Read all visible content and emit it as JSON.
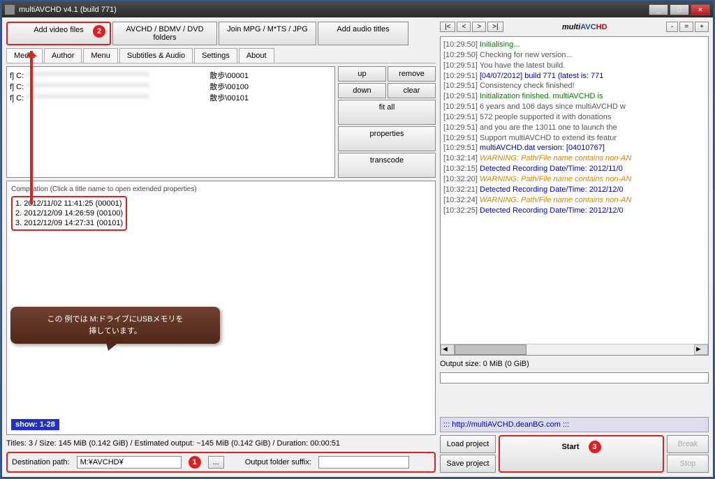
{
  "window": {
    "title": "multiAVCHD v4.1 (build 771)"
  },
  "topButtons": {
    "addVideo": "Add video files",
    "avchd": "AVCHD / BDMV / DVD folders",
    "joinmpg": "Join MPG / M*TS / JPG",
    "addAudio": "Add audio titles"
  },
  "tabs": {
    "media": "Media",
    "author": "Author",
    "menu": "Menu",
    "subtitles": "Subtitles & Audio",
    "settings": "Settings",
    "about": "About"
  },
  "fileRows": [
    {
      "prefix": "f] C:",
      "suffix": "散歩\\00001"
    },
    {
      "prefix": "f] C:",
      "suffix": "散歩\\00100"
    },
    {
      "prefix": "f] C:",
      "suffix": "散歩\\00101"
    }
  ],
  "side": {
    "up": "up",
    "remove": "remove",
    "down": "down",
    "clear": "clear",
    "fitall": "fit all",
    "properties": "properties",
    "transcode": "transcode"
  },
  "compilation": {
    "legend": "Compilation (Click a title name to open extended properties)",
    "items": [
      "1. 2012/11/02 11:41:25 (00001)",
      "2. 2012/12/09 14:26:59 (00100)",
      "3. 2012/12/09 14:27:31 (00101)"
    ],
    "show": "show: 1-28"
  },
  "status": {
    "line": "Titles: 3 / Size: 145 MiB (0.142 GiB) / Estimated output: ~145 MiB (0.142 GiB) / Duration: 00:00:51"
  },
  "dest": {
    "label": "Destination path:",
    "value": "M:¥AVCHD¥",
    "browse": "...",
    "suffixLabel": "Output folder suffix:",
    "suffixValue": ""
  },
  "hint": {
    "line1": "この 例では M:ドライブにUSBメモリを",
    "line2": "挿しています。"
  },
  "logNav": {
    "first": "|<",
    "prev": "<",
    "next": ">",
    "last": ">|",
    "minus": "- ",
    "eq": "=",
    "plus": "+"
  },
  "logo": {
    "multi": "multi",
    "avc": "AVC",
    "hd": "HD"
  },
  "logs": [
    {
      "ts": "[10:29:50]",
      "cls": "green",
      "text": " Initialising..."
    },
    {
      "ts": "[10:29:50]",
      "cls": "normal",
      "text": " Checking for new version..."
    },
    {
      "ts": "[10:29:51]",
      "cls": "normal",
      "text": " You have the latest build."
    },
    {
      "ts": "[10:29:51]",
      "cls": "blue",
      "text": " [04/07/2012] build 771 (latest is: 771"
    },
    {
      "ts": "[10:29:51]",
      "cls": "normal",
      "text": " Consistency check finished!"
    },
    {
      "ts": "[10:29:51]",
      "cls": "green",
      "text": " Initialization finished. multiAVCHD is"
    },
    {
      "ts": "",
      "cls": "normal",
      "text": " "
    },
    {
      "ts": "[10:29:51]",
      "cls": "normal",
      "text": " 6 years and 106 days since multiAVCHD w"
    },
    {
      "ts": "[10:29:51]",
      "cls": "normal",
      "text": " 572 people supported it with donations"
    },
    {
      "ts": "[10:29:51]",
      "cls": "normal",
      "text": " and you are the 13011 one to launch the"
    },
    {
      "ts": "[10:29:51]",
      "cls": "normal",
      "text": " Support multiAVCHD to extend its featur"
    },
    {
      "ts": "",
      "cls": "normal",
      "text": " "
    },
    {
      "ts": "[10:29:51]",
      "cls": "blue",
      "text": " multiAVCHD.dat version: [04010767]"
    },
    {
      "ts": "[10:32:14]",
      "cls": "warn",
      "text": " WARNING: Path/File name contains non-AN"
    },
    {
      "ts": "[10:32:15]",
      "cls": "blue",
      "text": " Detected Recording Date/Time: 2012/11/0"
    },
    {
      "ts": "[10:32:20]",
      "cls": "warn",
      "text": " WARNING: Path/File name contains non-AN"
    },
    {
      "ts": "[10:32:21]",
      "cls": "blue",
      "text": " Detected Recording Date/Time: 2012/12/0"
    },
    {
      "ts": "[10:32:24]",
      "cls": "warn",
      "text": " WARNING: Path/File name contains non-AN"
    },
    {
      "ts": "[10:32:25]",
      "cls": "blue",
      "text": " Detected Recording Date/Time: 2012/12/0"
    }
  ],
  "outputSize": "Output size: 0 MiB (0 GiB)",
  "url": " ::: http://multiAVCHD.deanBG.com :::",
  "bottom": {
    "load": "Load project",
    "save": "Save project",
    "start": "Start",
    "break": "Break",
    "stop": "Stop"
  },
  "badges": {
    "b1": "1",
    "b2": "2",
    "b3": "3"
  }
}
